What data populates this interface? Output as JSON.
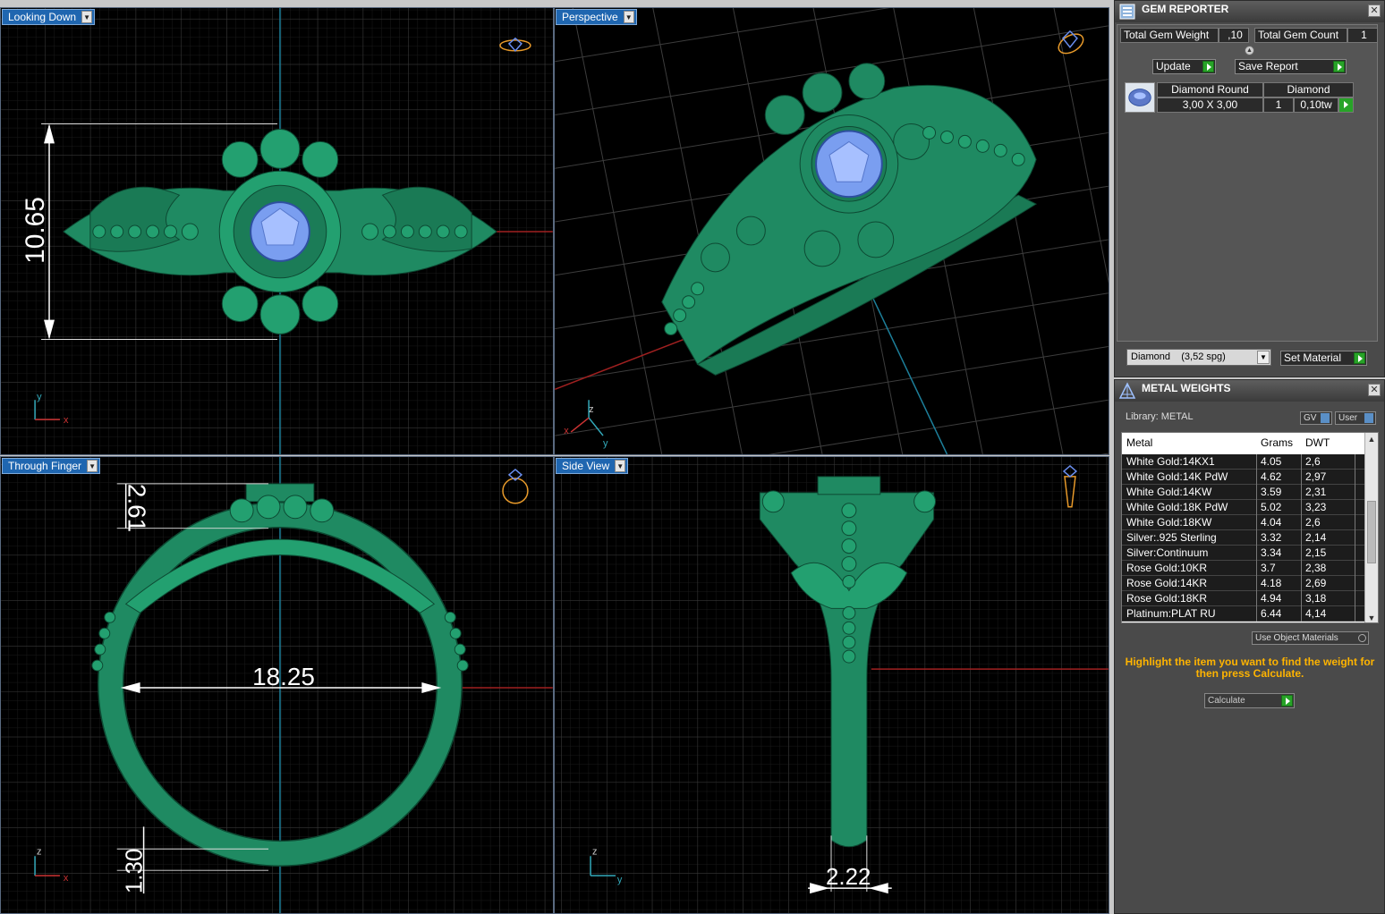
{
  "viewports": {
    "top_left": {
      "label": "Looking Down",
      "dimension": "10.65"
    },
    "top_right": {
      "label": "Perspective"
    },
    "bottom_left": {
      "label": "Through Finger",
      "dimension_inner": "18.25",
      "dimension_top": "2.61",
      "dimension_bottom": "1.30"
    },
    "bottom_right": {
      "label": "Side View",
      "dimension": "2.22"
    }
  },
  "axes": {
    "x": "x",
    "y": "y",
    "z": "z"
  },
  "gem_reporter": {
    "title": "GEM REPORTER",
    "total_gem_weight_label": "Total Gem Weight",
    "total_gem_weight_value": ",10",
    "total_gem_count_label": "Total Gem Count",
    "total_gem_count_value": "1",
    "update_label": "Update",
    "save_report_label": "Save Report",
    "gem": {
      "name": "Diamond Round",
      "type": "Diamond",
      "size": "3,00 X 3,00",
      "count": "1",
      "weight": "0,10tw"
    },
    "material_select": "Diamond    (3,52 spg)",
    "set_material_label": "Set Material"
  },
  "metal_weights": {
    "title": "METAL WEIGHTS",
    "library_label": "Library: METAL",
    "gv_label": "GV",
    "user_label": "User",
    "columns": [
      "Metal",
      "Grams",
      "DWT"
    ],
    "rows": [
      [
        "White Gold:14KX1",
        "4.05",
        "2,6"
      ],
      [
        "White Gold:14K PdW",
        "4.62",
        "2,97"
      ],
      [
        "White Gold:14KW",
        "3.59",
        "2,31"
      ],
      [
        "White Gold:18K PdW",
        "5.02",
        "3,23"
      ],
      [
        "White Gold:18KW",
        "4.04",
        "2,6"
      ],
      [
        "Silver:.925 Sterling",
        "3.32",
        "2,14"
      ],
      [
        "Silver:Continuum",
        "3.34",
        "2,15"
      ],
      [
        "Rose Gold:10KR",
        "3.7",
        "2,38"
      ],
      [
        "Rose Gold:14KR",
        "4.18",
        "2,69"
      ],
      [
        "Rose Gold:18KR",
        "4.94",
        "3,18"
      ],
      [
        "Platinum:PLAT RU",
        "6.44",
        "4,14"
      ]
    ],
    "use_object_materials_label": "Use Object Materials",
    "hint": "Highlight the item you want to find the weight for then press Calculate.",
    "calculate_label": "Calculate"
  },
  "colors": {
    "metal": "#1f8a62",
    "gem": "#7a9ef0",
    "grid": "#3a3a3a",
    "label_bg": "#1f66b0",
    "hint": "#ffb400"
  }
}
